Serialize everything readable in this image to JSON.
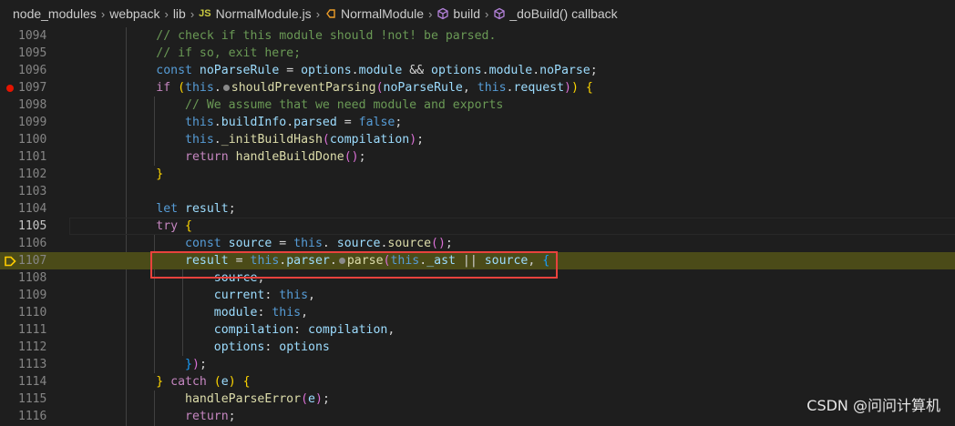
{
  "breadcrumb": {
    "items": [
      "node_modules",
      "webpack",
      "lib",
      "NormalModule.js",
      "NormalModule",
      "build",
      "_doBuild() callback"
    ],
    "file_badge": "JS"
  },
  "editor": {
    "first_line": 1094,
    "breakpoint_line": 1097,
    "current_stop_line": 1107,
    "active_line": 1105,
    "lines": [
      [
        [
          "cmt",
          "            // check if this module should !not! be parsed."
        ]
      ],
      [
        [
          "cmt",
          "            // if so, exit here;"
        ]
      ],
      [
        [
          "kw",
          "            const "
        ],
        [
          "var",
          "noParseRule"
        ],
        [
          "pl",
          " = "
        ],
        [
          "var",
          "options"
        ],
        [
          "pl",
          "."
        ],
        [
          "var",
          "module"
        ],
        [
          "pl",
          " && "
        ],
        [
          "var",
          "options"
        ],
        [
          "pl",
          "."
        ],
        [
          "var",
          "module"
        ],
        [
          "pl",
          "."
        ],
        [
          "var",
          "noParse"
        ],
        [
          "pl",
          ";"
        ]
      ],
      [
        [
          "ctl",
          "            if "
        ],
        [
          "br1",
          "("
        ],
        [
          "kw",
          "this"
        ],
        [
          "pl",
          "."
        ],
        [
          "dot",
          ""
        ],
        [
          "fn",
          "shouldPreventParsing"
        ],
        [
          "br2",
          "("
        ],
        [
          "var",
          "noParseRule"
        ],
        [
          "pl",
          ", "
        ],
        [
          "kw",
          "this"
        ],
        [
          "pl",
          "."
        ],
        [
          "var",
          "request"
        ],
        [
          "br2",
          ")"
        ],
        [
          "br1",
          ")"
        ],
        [
          "pl",
          " "
        ],
        [
          "br1",
          "{"
        ]
      ],
      [
        [
          "cmt",
          "                // We assume that we need module and exports"
        ]
      ],
      [
        [
          "kw",
          "                this"
        ],
        [
          "pl",
          "."
        ],
        [
          "var",
          "buildInfo"
        ],
        [
          "pl",
          "."
        ],
        [
          "var",
          "parsed"
        ],
        [
          "pl",
          " = "
        ],
        [
          "kw",
          "false"
        ],
        [
          "pl",
          ";"
        ]
      ],
      [
        [
          "kw",
          "                this"
        ],
        [
          "pl",
          "."
        ],
        [
          "fn",
          "_initBuildHash"
        ],
        [
          "br2",
          "("
        ],
        [
          "var",
          "compilation"
        ],
        [
          "br2",
          ")"
        ],
        [
          "pl",
          ";"
        ]
      ],
      [
        [
          "ctl",
          "                return "
        ],
        [
          "fn",
          "handleBuildDone"
        ],
        [
          "br2",
          "()"
        ],
        [
          "pl",
          ";"
        ]
      ],
      [
        [
          "br1",
          "            }"
        ]
      ],
      [
        [
          "pl",
          ""
        ]
      ],
      [
        [
          "kw",
          "            let "
        ],
        [
          "var",
          "result"
        ],
        [
          "pl",
          ";"
        ]
      ],
      [
        [
          "ctl",
          "            try "
        ],
        [
          "br1",
          "{"
        ]
      ],
      [
        [
          "kw",
          "                const "
        ],
        [
          "var",
          "source"
        ],
        [
          "pl",
          " = "
        ],
        [
          "kw",
          "this"
        ],
        [
          "pl",
          ". "
        ],
        [
          "var",
          "source"
        ],
        [
          "pl",
          "."
        ],
        [
          "fn",
          "source"
        ],
        [
          "br2",
          "()"
        ],
        [
          "pl",
          ";"
        ]
      ],
      [
        [
          "var",
          "                result"
        ],
        [
          "pl",
          " = "
        ],
        [
          "kw",
          "this"
        ],
        [
          "pl",
          "."
        ],
        [
          "var",
          "parser"
        ],
        [
          "pl",
          "."
        ],
        [
          "dot",
          ""
        ],
        [
          "fn",
          "parse"
        ],
        [
          "br2",
          "("
        ],
        [
          "kw",
          "this"
        ],
        [
          "pl",
          "."
        ],
        [
          "var",
          "_ast"
        ],
        [
          "pl",
          " || "
        ],
        [
          "var",
          "source"
        ],
        [
          "pl",
          ", "
        ],
        [
          "br3",
          "{"
        ]
      ],
      [
        [
          "var",
          "                    source"
        ],
        [
          "pl",
          ","
        ]
      ],
      [
        [
          "var",
          "                    current"
        ],
        [
          "pl",
          ": "
        ],
        [
          "kw",
          "this"
        ],
        [
          "pl",
          ","
        ]
      ],
      [
        [
          "var",
          "                    module"
        ],
        [
          "pl",
          ": "
        ],
        [
          "kw",
          "this"
        ],
        [
          "pl",
          ","
        ]
      ],
      [
        [
          "var",
          "                    compilation"
        ],
        [
          "pl",
          ": "
        ],
        [
          "var",
          "compilation"
        ],
        [
          "pl",
          ","
        ]
      ],
      [
        [
          "var",
          "                    options"
        ],
        [
          "pl",
          ": "
        ],
        [
          "var",
          "options"
        ]
      ],
      [
        [
          "br3",
          "                }"
        ],
        [
          "br2",
          ")"
        ],
        [
          "pl",
          ";"
        ]
      ],
      [
        [
          "br1",
          "            }"
        ],
        [
          "ctl",
          " catch "
        ],
        [
          "br1",
          "("
        ],
        [
          "var",
          "e"
        ],
        [
          "br1",
          ")"
        ],
        [
          "pl",
          " "
        ],
        [
          "br1",
          "{"
        ]
      ],
      [
        [
          "fn",
          "                handleParseError"
        ],
        [
          "br2",
          "("
        ],
        [
          "var",
          "e"
        ],
        [
          "br2",
          ")"
        ],
        [
          "pl",
          ";"
        ]
      ],
      [
        [
          "ctl",
          "                return"
        ],
        [
          "pl",
          ";"
        ]
      ]
    ]
  },
  "watermark": "CSDN @问问计算机",
  "colors": {
    "background": "#1e1e1e",
    "current_line_highlight": "#4b4b18",
    "breakpoint": "#e51400",
    "annotation_box": "#e8423d"
  }
}
